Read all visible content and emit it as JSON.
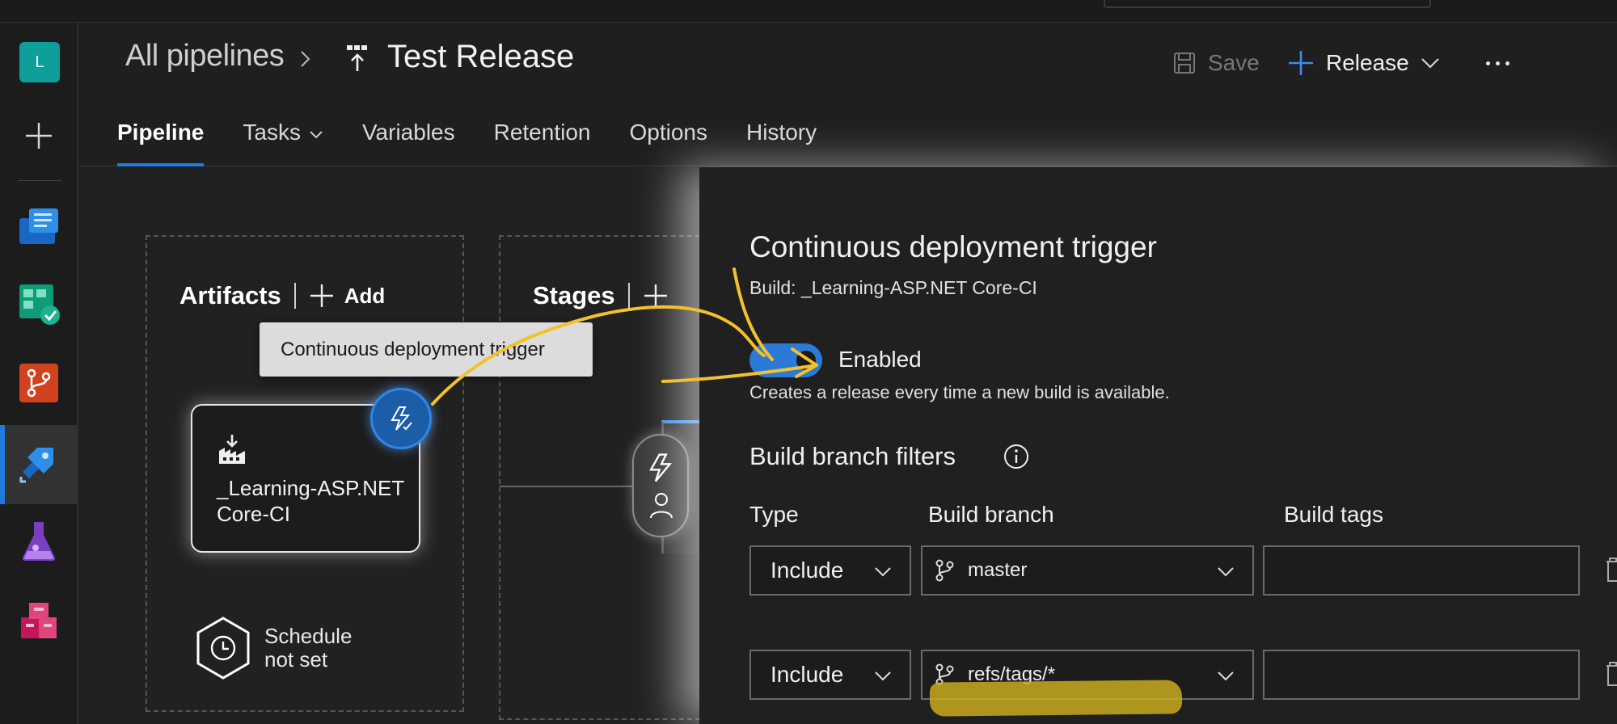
{
  "org": {
    "initial": "L",
    "color": "#0f9f9a"
  },
  "rail": {
    "services": [
      "overview-icon",
      "boards-icon",
      "repos-icon",
      "pipelines-icon",
      "test-plans-icon",
      "artifacts-icon"
    ],
    "active": "pipelines-icon",
    "accent": "#1f7ae0"
  },
  "header": {
    "breadcrumb_root": "All pipelines",
    "title": "Test Release",
    "save_label": "Save",
    "release_label": "Release"
  },
  "tabs": [
    {
      "label": "Pipeline",
      "active": true
    },
    {
      "label": "Tasks",
      "dropdown": true
    },
    {
      "label": "Variables"
    },
    {
      "label": "Retention"
    },
    {
      "label": "Options"
    },
    {
      "label": "History"
    }
  ],
  "canvas": {
    "artifacts_heading": "Artifacts",
    "add_label": "Add",
    "stages_heading": "Stages",
    "tooltip": "Continuous deployment trigger",
    "artifact_name": "_Learning-ASP.NET Core-CI",
    "schedule_label": "Schedule not set"
  },
  "panel": {
    "title": "Continuous deployment trigger",
    "subtitle": "Build: _Learning-ASP.NET Core-CI",
    "toggle_label": "Enabled",
    "toggle_on": true,
    "description": "Creates a release every time a new build is available.",
    "section_title": "Build branch filters",
    "columns": {
      "type": "Type",
      "branch": "Build branch",
      "tags": "Build tags"
    },
    "filters": [
      {
        "type": "Include",
        "branch": "master",
        "tags": ""
      },
      {
        "type": "Include",
        "branch": "refs/tags/*",
        "tags": ""
      }
    ]
  },
  "annotations": {
    "ink_color": "#f2c12e",
    "highlight_color": "#c8aa1e"
  }
}
